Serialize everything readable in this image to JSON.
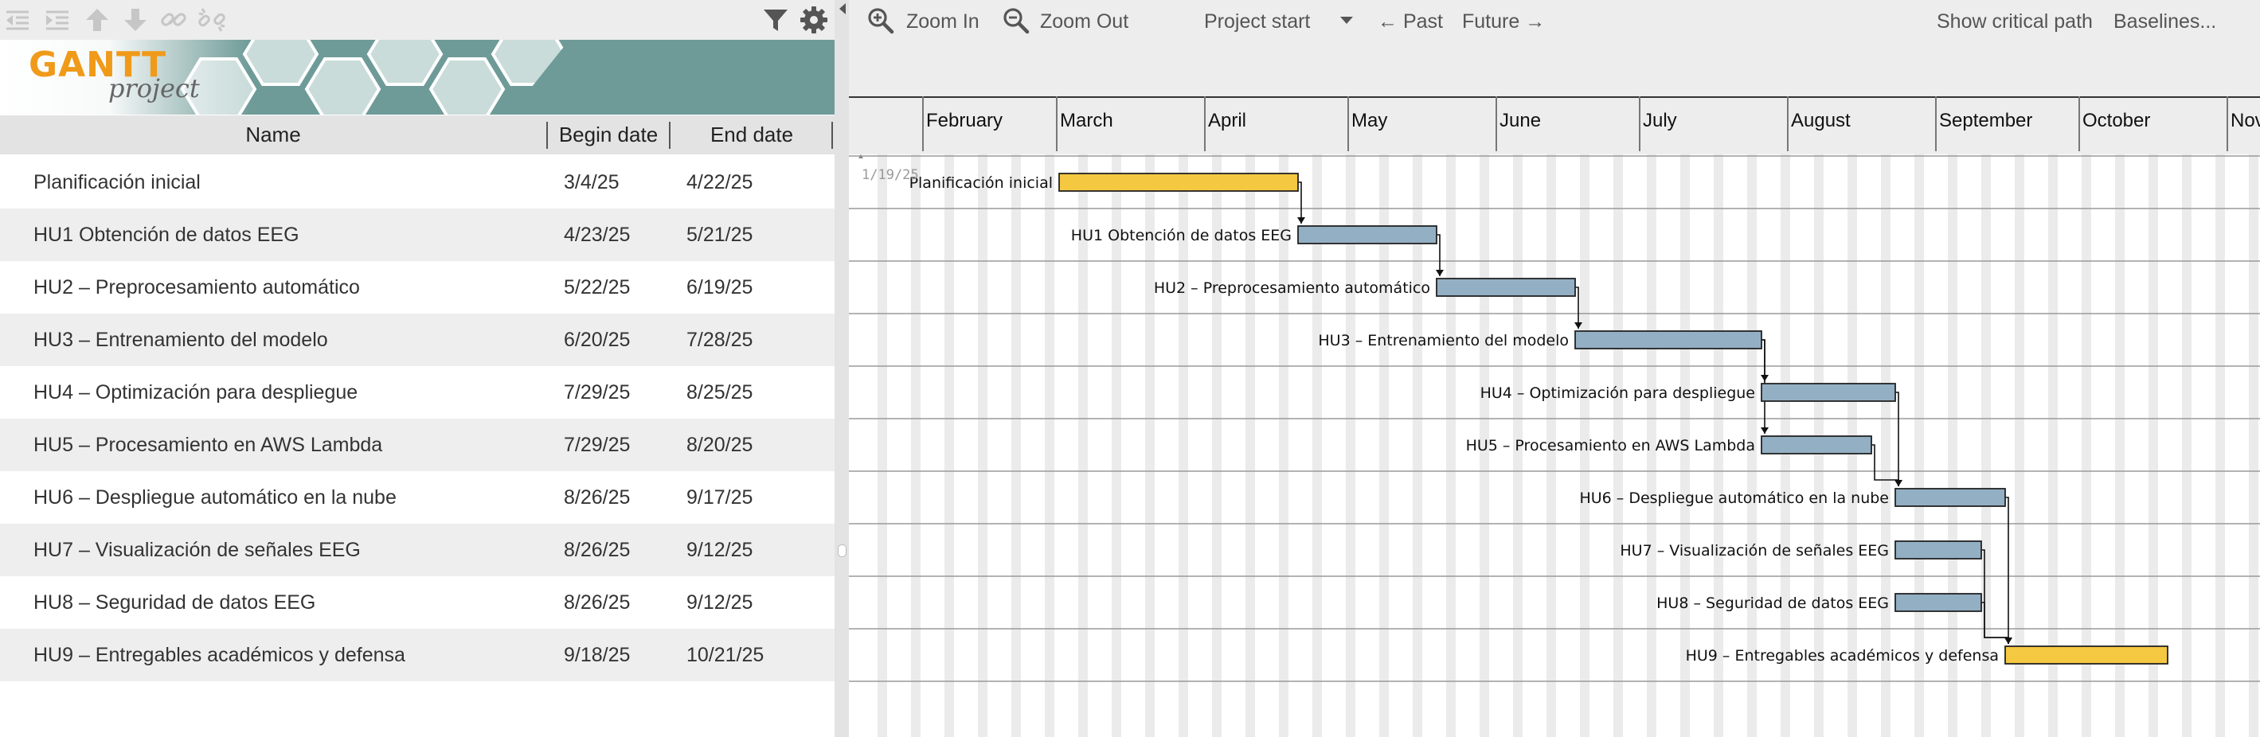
{
  "app": {
    "logo_text": "GANTT",
    "logo_subtext": "project"
  },
  "toolbar": {
    "icons": [
      "outdent-icon",
      "indent-icon",
      "move-up-icon",
      "move-down-icon",
      "link-icon",
      "unlink-icon",
      "filter-icon",
      "gear-icon"
    ]
  },
  "table": {
    "columns": {
      "name": "Name",
      "begin": "Begin date",
      "end": "End date"
    },
    "rows": [
      {
        "name": "Planificación inicial",
        "begin": "3/4/25",
        "end": "4/22/25"
      },
      {
        "name": "HU1 Obtención de datos EEG",
        "begin": "4/23/25",
        "end": "5/21/25"
      },
      {
        "name": "HU2 – Preprocesamiento automático",
        "begin": "5/22/25",
        "end": "6/19/25"
      },
      {
        "name": "HU3 – Entrenamiento del modelo",
        "begin": "6/20/25",
        "end": "7/28/25"
      },
      {
        "name": "HU4 – Optimización para despliegue",
        "begin": "7/29/25",
        "end": "8/25/25"
      },
      {
        "name": "HU5 – Procesamiento en AWS Lambda",
        "begin": "7/29/25",
        "end": "8/20/25"
      },
      {
        "name": "HU6 – Despliegue automático en la nube",
        "begin": "8/26/25",
        "end": "9/17/25"
      },
      {
        "name": "HU7 – Visualización de señales EEG",
        "begin": "8/26/25",
        "end": "9/12/25"
      },
      {
        "name": "HU8 – Seguridad de datos EEG",
        "begin": "8/26/25",
        "end": "9/12/25"
      },
      {
        "name": "HU9 – Entregables académicos y defensa",
        "begin": "9/18/25",
        "end": "10/21/25"
      }
    ]
  },
  "chart_toolbar": {
    "zoom_in": "Zoom In",
    "zoom_out": "Zoom Out",
    "project_start": "Project start",
    "past": "← Past",
    "future": "Future →",
    "critical_path": "Show critical path",
    "baselines": "Baselines..."
  },
  "timeline": {
    "start_marker": "1/19/25",
    "months": [
      "February",
      "March",
      "April",
      "May",
      "June",
      "July",
      "August",
      "September",
      "October",
      "Nov"
    ]
  },
  "colors": {
    "milestone_bar": "#f5c842",
    "task_bar": "#93afc4",
    "accent": "#6e9b98"
  },
  "chart_data": {
    "type": "gantt",
    "tasks": [
      {
        "name": "Planificación inicial",
        "start": "2025-03-04",
        "end": "2025-04-22",
        "style": "yellow",
        "successors": [
          1
        ]
      },
      {
        "name": "HU1 Obtención de datos EEG",
        "start": "2025-04-23",
        "end": "2025-05-21",
        "style": "blue",
        "successors": [
          2
        ]
      },
      {
        "name": "HU2 – Preprocesamiento automático",
        "start": "2025-05-22",
        "end": "2025-06-19",
        "style": "blue",
        "successors": [
          3
        ]
      },
      {
        "name": "HU3 – Entrenamiento del modelo",
        "start": "2025-06-20",
        "end": "2025-07-28",
        "style": "blue",
        "successors": [
          4,
          5
        ]
      },
      {
        "name": "HU4 – Optimización para despliegue",
        "start": "2025-07-29",
        "end": "2025-08-25",
        "style": "blue",
        "successors": [
          6
        ]
      },
      {
        "name": "HU5 – Procesamiento en AWS Lambda",
        "start": "2025-07-29",
        "end": "2025-08-20",
        "style": "blue",
        "successors": [
          6
        ]
      },
      {
        "name": "HU6 – Despliegue automático en la nube",
        "start": "2025-08-26",
        "end": "2025-09-17",
        "style": "blue",
        "successors": [
          9
        ]
      },
      {
        "name": "HU7 – Visualización de señales EEG",
        "start": "2025-08-26",
        "end": "2025-09-12",
        "style": "blue",
        "successors": [
          9
        ]
      },
      {
        "name": "HU8 – Seguridad de datos EEG",
        "start": "2025-08-26",
        "end": "2025-09-12",
        "style": "blue",
        "successors": [
          9
        ]
      },
      {
        "name": "HU9 – Entregables académicos y defensa",
        "start": "2025-09-18",
        "end": "2025-10-21",
        "style": "yellow",
        "successors": []
      }
    ]
  }
}
